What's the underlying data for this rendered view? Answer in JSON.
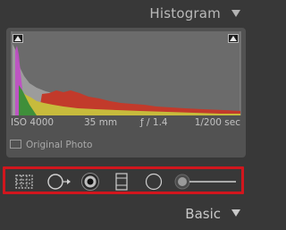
{
  "histogram": {
    "title": "Histogram",
    "metadata": {
      "iso": "ISO 4000",
      "focal_length": "35 mm",
      "aperture": "ƒ / 1.4",
      "shutter": "1/200 sec"
    },
    "original_photo_label": "Original Photo",
    "shadow_clip_icon": "triangle-up-icon",
    "highlight_clip_icon": "triangle-up-icon"
  },
  "tools": [
    {
      "name": "crop-tool",
      "icon": "crop-icon"
    },
    {
      "name": "spot-removal-tool",
      "icon": "spot-removal-icon"
    },
    {
      "name": "red-eye-tool",
      "icon": "red-eye-icon"
    },
    {
      "name": "graduated-filter-tool",
      "icon": "graduated-filter-icon"
    },
    {
      "name": "radial-filter-tool",
      "icon": "radial-filter-icon"
    },
    {
      "name": "adjustment-brush-tool",
      "icon": "adjustment-brush-icon"
    }
  ],
  "highlight_color": "#d1161d",
  "basic": {
    "title": "Basic"
  }
}
